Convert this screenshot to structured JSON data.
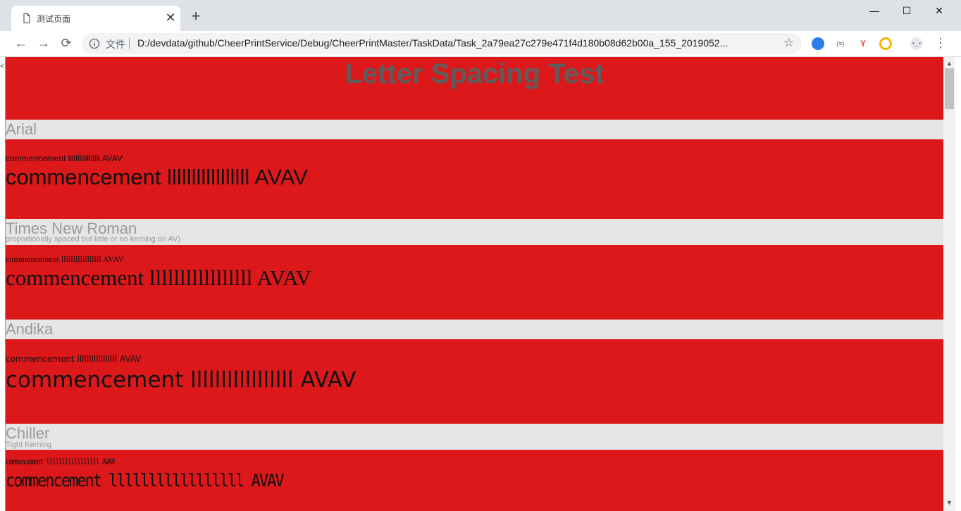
{
  "browser": {
    "tab_title": "测试页面",
    "tab_close": "✕",
    "new_tab": "+",
    "window_controls": {
      "minimize": "—",
      "maximize": "☐",
      "close": "✕"
    },
    "nav": {
      "back": "←",
      "forward": "→",
      "reload": "⟳"
    },
    "address": {
      "scheme_label": "文件",
      "url": "D:/devdata/github/CheerPrintService/Debug/CheerPrintMaster/TaskData/Task_2a79ea27c279e471f4d180b08d62b00a_155_2019052...",
      "star": "☆"
    },
    "extensions": [
      {
        "name": "globe-extension-icon",
        "glyph": "",
        "color": "#2b7de9"
      },
      {
        "name": "json-extension-icon",
        "glyph": "{≡}",
        "color": "#5f6368"
      },
      {
        "name": "y-extension-icon",
        "glyph": "Y",
        "color": "#e0442a"
      },
      {
        "name": "compass-extension-icon",
        "glyph": "",
        "color": "#f4b400"
      },
      {
        "name": "profile-avatar-icon",
        "glyph": "•‿•",
        "color": "#5f6368"
      }
    ],
    "menu": "⋮"
  },
  "page": {
    "left_edge_mark": "<",
    "title": "Letter Spacing Test",
    "sample_text": "commencement lllllllllllllllll AVAV",
    "sections": [
      {
        "font": "Arial",
        "note": ""
      },
      {
        "font": "Times New Roman",
        "note": "proportionally spaced but little or no kerning on AV)"
      },
      {
        "font": "Andika",
        "note": ""
      },
      {
        "font": "Chiller",
        "note": "Tight Kerning"
      }
    ]
  },
  "colors": {
    "page_background_red": "#dc181b",
    "label_band_gray": "#e5e5e5",
    "title_text": "#5e5c5c",
    "label_text": "#9a9a9a"
  }
}
